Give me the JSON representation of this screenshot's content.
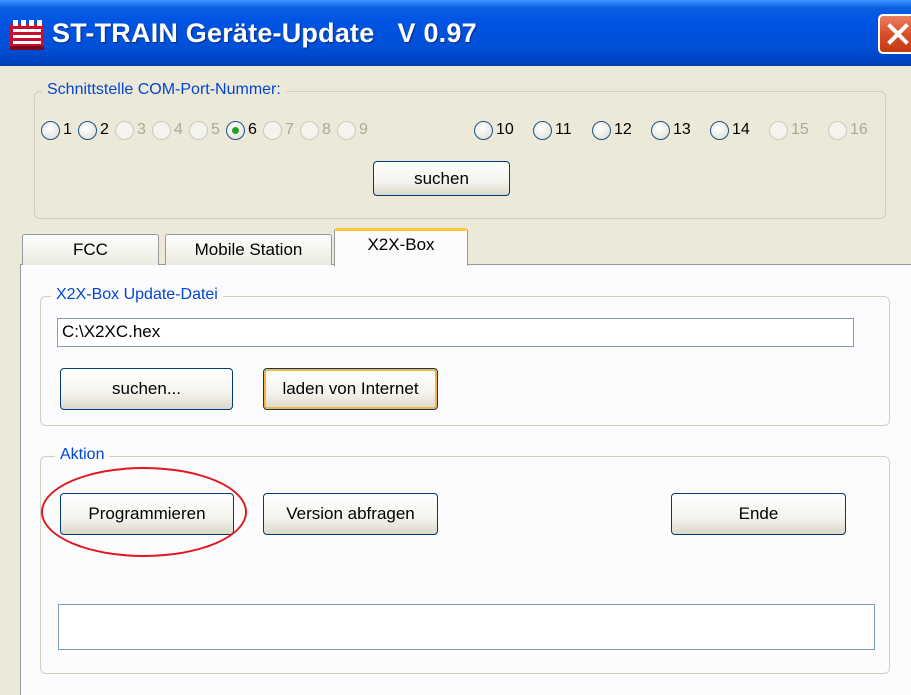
{
  "window": {
    "title": "ST-TRAIN Geräte-Update   V 0.97",
    "accent": "#0054e3"
  },
  "com_port_group": {
    "label": "Schnittstelle COM-Port-Nummer:",
    "ports": [
      {
        "label": "1",
        "enabled": true,
        "selected": false
      },
      {
        "label": "2",
        "enabled": true,
        "selected": false
      },
      {
        "label": "3",
        "enabled": false,
        "selected": false
      },
      {
        "label": "4",
        "enabled": false,
        "selected": false
      },
      {
        "label": "5",
        "enabled": false,
        "selected": false
      },
      {
        "label": "6",
        "enabled": true,
        "selected": true
      },
      {
        "label": "7",
        "enabled": false,
        "selected": false
      },
      {
        "label": "8",
        "enabled": false,
        "selected": false
      },
      {
        "label": "9",
        "enabled": false,
        "selected": false
      },
      {
        "label": "10",
        "enabled": true,
        "selected": false
      },
      {
        "label": "11",
        "enabled": true,
        "selected": false
      },
      {
        "label": "12",
        "enabled": true,
        "selected": false
      },
      {
        "label": "13",
        "enabled": true,
        "selected": false
      },
      {
        "label": "14",
        "enabled": true,
        "selected": false
      },
      {
        "label": "15",
        "enabled": false,
        "selected": false
      },
      {
        "label": "16",
        "enabled": false,
        "selected": false
      }
    ],
    "search_button": "suchen"
  },
  "tabs": [
    {
      "label": "FCC",
      "active": false
    },
    {
      "label": "Mobile Station",
      "active": false
    },
    {
      "label": "X2X-Box",
      "active": true
    }
  ],
  "update_file_group": {
    "label": "X2X-Box Update-Datei",
    "file_path": "C:\\X2XC.hex",
    "browse_button": "suchen...",
    "download_button": "laden von Internet"
  },
  "action_group": {
    "label": "Aktion",
    "program_button": "Programmieren",
    "version_button": "Version abfragen",
    "exit_button": "Ende",
    "status_value": ""
  }
}
